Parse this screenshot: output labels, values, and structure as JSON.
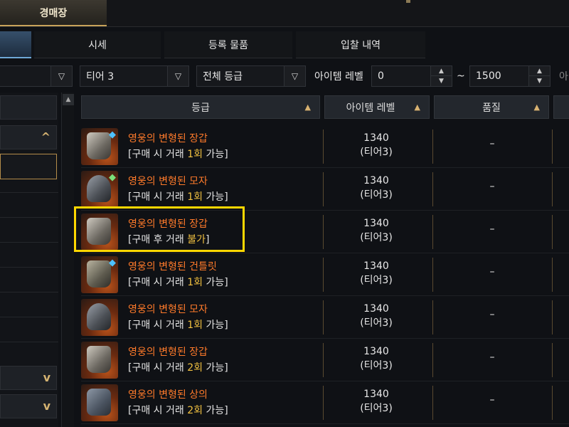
{
  "header": {
    "main_tab": "경매장"
  },
  "subtabs": [
    "시세",
    "등록 물품",
    "입찰 내역"
  ],
  "filters": {
    "tier": "티어 3",
    "grade": "전체 등급",
    "item_level_label": "아이템 레벨",
    "level_min": "0",
    "tilde": "~",
    "level_max": "1500",
    "cut_label": "아"
  },
  "table": {
    "headers": {
      "grade": "등급",
      "item_level": "아이템 레벨",
      "quality": "품질"
    },
    "rows": [
      {
        "name": "영웅의 변형된 장갑",
        "note_pre": "[구매 시 거래 ",
        "note_hl": "1회",
        "note_post": " 가능]",
        "level": "1340",
        "tier": "(티어3)",
        "quality": "–",
        "icon": "gloves-icon"
      },
      {
        "name": "영웅의 변형된 모자",
        "note_pre": "[구매 시 거래 ",
        "note_hl": "1회",
        "note_post": " 가능]",
        "level": "1340",
        "tier": "(티어3)",
        "quality": "–",
        "icon": "helmet-icon"
      },
      {
        "name": "영웅의 변형된 장갑",
        "note_pre": "[구매 후 거래 ",
        "note_hl": "불가",
        "note_post": "]",
        "level": "1340",
        "tier": "(티어3)",
        "quality": "–",
        "icon": "gloves-icon"
      },
      {
        "name": "영웅의 변형된 건틀릿",
        "note_pre": "[구매 시 거래 ",
        "note_hl": "1회",
        "note_post": " 가능]",
        "level": "1340",
        "tier": "(티어3)",
        "quality": "–",
        "icon": "gauntlet-icon"
      },
      {
        "name": "영웅의 변형된 모자",
        "note_pre": "[구매 시 거래 ",
        "note_hl": "1회",
        "note_post": " 가능]",
        "level": "1340",
        "tier": "(티어3)",
        "quality": "–",
        "icon": "helmet-icon"
      },
      {
        "name": "영웅의 변형된 장갑",
        "note_pre": "[구매 시 거래 ",
        "note_hl": "2회",
        "note_post": " 가능]",
        "level": "1340",
        "tier": "(티어3)",
        "quality": "–",
        "icon": "gloves-icon"
      },
      {
        "name": "영웅의 변형된 상의",
        "note_pre": "[구매 시 거래 ",
        "note_hl": "2회",
        "note_post": " 가능]",
        "level": "1340",
        "tier": "(티어3)",
        "quality": "–",
        "icon": "chest-armor-icon"
      }
    ]
  },
  "colors": {
    "item_name": "#ff7a2a",
    "highlight_border": "#ffd700",
    "accent_gold": "#d4b271"
  }
}
